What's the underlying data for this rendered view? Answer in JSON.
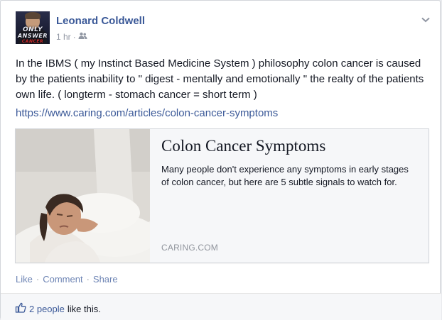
{
  "post": {
    "author": "Leonard Coldwell",
    "timestamp": "1 hr",
    "separator": "·",
    "audience_icon": "friends-icon",
    "avatar": {
      "line1": "ONLY",
      "line2": "ANSWER",
      "line3": "CANCER"
    },
    "text": "In the IBMS ( my Instinct Based Medicine System ) philosophy colon cancer is caused by the patients inability to \" digest - mentally and emotionally \" the realty of the patients own life. ( longterm - stomach cancer = short term )",
    "link": "https://www.caring.com/articles/colon-cancer-symptoms"
  },
  "link_card": {
    "title": "Colon Cancer Symptoms",
    "description": "Many people don't experience any symptoms in early stages of colon cancer, but here are 5 subtle signals to watch for.",
    "domain": "CARING.COM"
  },
  "actions": {
    "like": "Like",
    "comment": "Comment",
    "share": "Share",
    "separator": "·"
  },
  "likes": {
    "icon": "thumbs-up-icon",
    "people": "2 people",
    "suffix": "like this."
  },
  "colors": {
    "link_blue": "#3b5998",
    "muted": "#9197a3",
    "card_bg": "#f6f7f9"
  }
}
